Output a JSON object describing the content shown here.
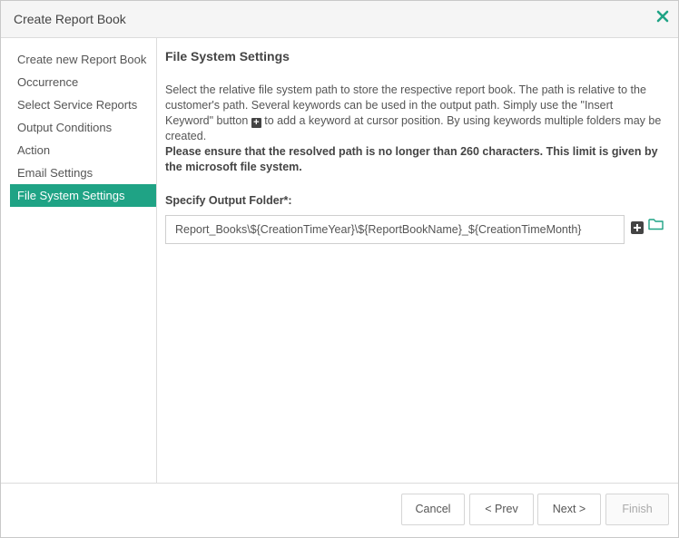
{
  "dialog": {
    "title": "Create Report Book",
    "close_icon": "close-icon",
    "accent_color": "#1fa385"
  },
  "sidebar": {
    "items": [
      {
        "label": "Create new Report Book",
        "active": false
      },
      {
        "label": "Occurrence",
        "active": false
      },
      {
        "label": "Select Service Reports",
        "active": false
      },
      {
        "label": "Output Conditions",
        "active": false
      },
      {
        "label": "Action",
        "active": false
      },
      {
        "label": "Email Settings",
        "active": false
      },
      {
        "label": "File System Settings",
        "active": true
      }
    ]
  },
  "main": {
    "heading": "File System Settings",
    "description_part1": "Select the relative file system path to store the respective report book. The path is relative to the customer's path. Several keywords can be used in the output path. Simply use the \"Insert Keyword\" button",
    "description_part2": "to add a keyword at cursor position. By using keywords multiple folders may be created.",
    "warning": "Please ensure that the resolved path is no longer than 260 characters. This limit is given by the microsoft file system.",
    "output_folder_label": "Specify Output Folder*:",
    "output_folder_value": "Report_Books\\${CreationTimeYear}\\${ReportBookName}_${CreationTimeMonth}",
    "insert_keyword_icon": "plus-square-icon",
    "browse_icon": "folder-icon"
  },
  "footer": {
    "cancel_label": "Cancel",
    "prev_label": "< Prev",
    "next_label": "Next >",
    "finish_label": "Finish"
  }
}
